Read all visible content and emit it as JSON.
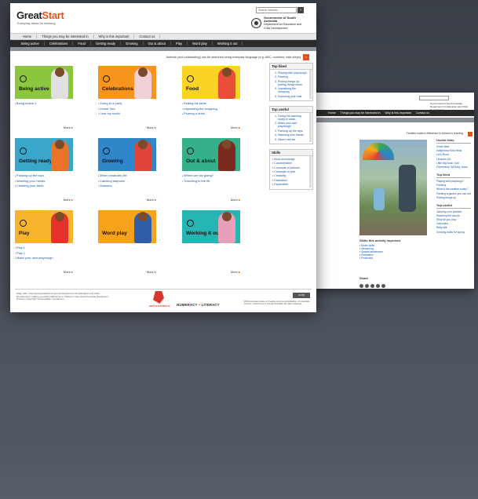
{
  "back_page": {
    "search_label": "Search website...",
    "gov": "Government of South Australia Department for Education and Child Development",
    "nav": [
      "Home",
      "Things you may be interested in",
      "Why is this important",
      "Contact us"
    ],
    "banner": "Families make a difference to children's learning",
    "useful_links": {
      "title": "Useful links",
      "items": [
        "Great Start",
        "Indigenous Kids Read",
        "Let's Read",
        "Libraries SA",
        "Little Big Book Club",
        "Partnership SA Early Years"
      ]
    },
    "top_rated": {
      "title": "Top liked",
      "items": [
        "Playing with playdough",
        "Painting",
        "What is the weather today?",
        "Planting a garden you can eat",
        "Picking things up"
      ]
    },
    "top_useful": {
      "title": "Top useful",
      "items": [
        "Jumping over puddles",
        "Watching the clouds",
        "Shop till you drop",
        "Calendars",
        "Baby talk",
        "Growing bulbs for spring"
      ]
    },
    "skills_title": "Skills this activity improves",
    "skills": [
      "Motor skills",
      "Measuring",
      "Spatial awareness",
      "Estimation",
      "Prediction"
    ],
    "share_label": "Share"
  },
  "header": {
    "logo_main": "Great",
    "logo_accent": "Start",
    "tagline": "Everyday ideas for learning",
    "search_placeholder": "Search website...",
    "search_go": "›",
    "gov_title": "Government of South Australia",
    "gov_sub": "Department for Education and Child Development"
  },
  "nav_primary": [
    "Home",
    "Things you may be interested in",
    "Why is this important",
    "Contact us"
  ],
  "nav_categories": [
    "Being active",
    "Celebrations",
    "Food",
    "Getting ready",
    "Growing",
    "Out & about",
    "Play",
    "Word play",
    "Working it out"
  ],
  "notice": {
    "text": "Asterisk (and subheading) can be searched using everyday language (e.g. ABC, numbers, take steps)",
    "button": "›"
  },
  "tiles": [
    {
      "label": "Being active",
      "color": "#8cc63f",
      "child": "#e0e0e0",
      "links": [
        "Being Active 1"
      ],
      "more": "More"
    },
    {
      "label": "Celebrations",
      "color": "#f7941d",
      "child": "#f1d0d8",
      "links": [
        "Going to a party",
        "Grand Tour",
        "I lost my tooth!"
      ],
      "more": "More"
    },
    {
      "label": "Food",
      "color": "#f9d423",
      "child": "#ea4c3a",
      "links": [
        "Setting the table",
        "Unpacking the shopping",
        "Pouring a drink"
      ],
      "more": "More"
    },
    {
      "label": "Getting ready",
      "color": "#3aa6c9",
      "child": "#e8742a",
      "links": [
        "Packing up the toys",
        "Washing your hands",
        "Cleaning your teeth"
      ],
      "more": "More"
    },
    {
      "label": "Growing",
      "color": "#2f86c8",
      "child": "#e0443a",
      "links": [
        "When creatures die",
        "Catching tadpoles",
        "Seasons"
      ],
      "more": "More"
    },
    {
      "label": "Out & about",
      "color": "#35b08a",
      "child": "#7a2a20",
      "links": [
        "Where are we going?",
        "Travelling in the lift"
      ],
      "more": "More"
    },
    {
      "label": "Play",
      "color": "#f7b52e",
      "child": "#e4312b",
      "links": [
        "Play 1",
        "Play 1",
        "Make your own playdough"
      ],
      "more": "More"
    },
    {
      "label": "Word play",
      "color": "#f6a21b",
      "child": "#2e5ea8",
      "links": [],
      "more": "More"
    },
    {
      "label": "Working it out",
      "color": "#25b6b3",
      "child": "#e8a0b8",
      "links": [],
      "more": "More"
    }
  ],
  "sidebar": {
    "top_liked": {
      "title": "Top liked",
      "items": [
        "Playing with playdough",
        "Painting",
        "Picking things up, putting things down",
        "Unpacking the shopping",
        "Exploring junk mail"
      ]
    },
    "top_useful": {
      "title": "Top useful",
      "items": [
        "Going the washing ready to wash",
        "Make your own playdough",
        "Packing up the toys",
        "Washing your hands",
        "Where are we"
      ]
    },
    "skills": {
      "title": "Skills",
      "items": [
        "Book knowledge",
        "Concentration",
        "Concepts of pictures",
        "Concepts of print",
        "Creativity",
        "Estimation",
        "Exploration"
      ]
    }
  },
  "footer": {
    "fine_print": "Page URL: http://www.greatstart.sa.gov.au/ Department for Education and Child Development, making a positive difference to children's lives South Australia Disclaimer | Privacy | Copyright | Accessibility | Contact us",
    "sa_label": "SOUTH AUSTRALIA",
    "numeracy": "NUMERACY",
    "literacy": "LITERACY",
    "cc": "cc by",
    "copyright": "Works licensed under a Creative Commons Attribution 3.0 Australia Licence. Government of South Australia. All rights reserved."
  }
}
